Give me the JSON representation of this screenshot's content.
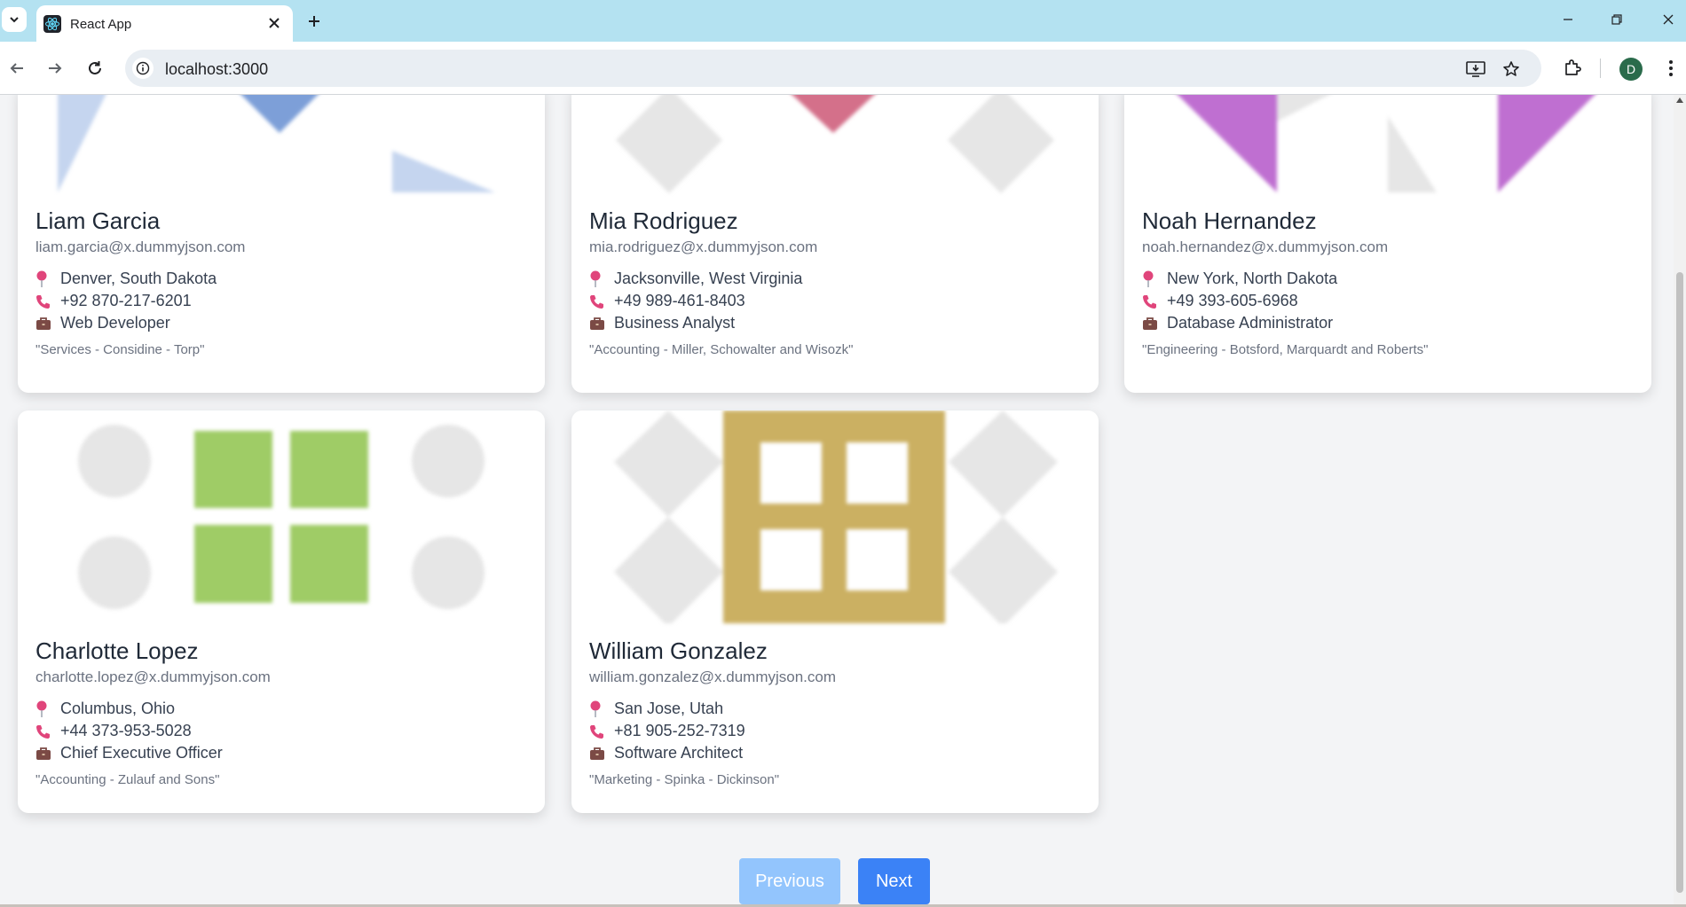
{
  "browser": {
    "tab_title": "React App",
    "url": "localhost:3000",
    "profile_initial": "D"
  },
  "users": [
    {
      "name": "Liam Garcia",
      "email": "liam.garcia@x.dummyjson.com",
      "location": "Denver, South Dakota",
      "phone": "+92 870-217-6201",
      "title": "Web Developer",
      "company": "\"Services - Considine - Torp\"",
      "avatar_color": "#6b8fd6"
    },
    {
      "name": "Mia Rodriguez",
      "email": "mia.rodriguez@x.dummyjson.com",
      "location": "Jacksonville, West Virginia",
      "phone": "+49 989-461-8403",
      "title": "Business Analyst",
      "company": "\"Accounting - Miller, Schowalter and Wisozk\"",
      "avatar_color": "#d4708a"
    },
    {
      "name": "Noah Hernandez",
      "email": "noah.hernandez@x.dummyjson.com",
      "location": "New York, North Dakota",
      "phone": "+49 393-605-6968",
      "title": "Database Administrator",
      "company": "\"Engineering - Botsford, Marquardt and Roberts\"",
      "avatar_color": "#bf6fd1"
    },
    {
      "name": "Charlotte Lopez",
      "email": "charlotte.lopez@x.dummyjson.com",
      "location": "Columbus, Ohio",
      "phone": "+44 373-953-5028",
      "title": "Chief Executive Officer",
      "company": "\"Accounting - Zulauf and Sons\"",
      "avatar_color": "#9fcc66"
    },
    {
      "name": "William Gonzalez",
      "email": "william.gonzalez@x.dummyjson.com",
      "location": "San Jose, Utah",
      "phone": "+81 905-252-7319",
      "title": "Software Architect",
      "company": "\"Marketing - Spinka - Dickinson\"",
      "avatar_color": "#cbb062"
    }
  ],
  "pagination": {
    "previous_label": "Previous",
    "next_label": "Next"
  }
}
